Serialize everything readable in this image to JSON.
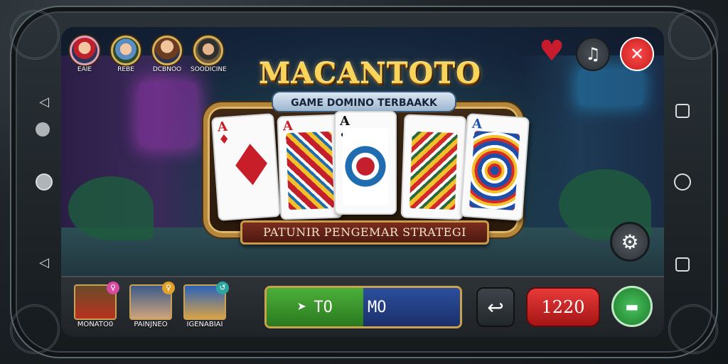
{
  "players": [
    {
      "name": "EAIE",
      "icon": "player-avatar-icon"
    },
    {
      "name": "REBE",
      "icon": "player-avatar-icon"
    },
    {
      "name": "DCBNOO",
      "icon": "player-avatar-icon"
    },
    {
      "name": "SOODICINE",
      "icon": "player-avatar-icon"
    }
  ],
  "title": "MACANTOTO",
  "subtitle": "GAME DOMINO TERBAAKK",
  "cards": [
    {
      "rank": "A",
      "suit": "♦"
    },
    {
      "rank": "A",
      "suit": "♦"
    },
    {
      "rank": "A",
      "suit": "♣"
    },
    {
      "rank": "",
      "suit": ""
    },
    {
      "rank": "A",
      "suit": "♠"
    }
  ],
  "banner": "PATUNIR PENGEMAR STRATEGI",
  "bottom": {
    "items": [
      {
        "label": "MONATO0",
        "badge": "♀"
      },
      {
        "label": "PAINJNEO",
        "badge": "♀"
      },
      {
        "label": "IGENABIAI",
        "badge": "↺"
      }
    ],
    "play_left": "TO",
    "play_right": "MO",
    "score": "1220"
  },
  "colors": {
    "accent_gold": "#f9d45a",
    "play_green": "#4caf3a",
    "play_blue": "#2c4f9e",
    "score_red": "#e83a3a",
    "close_red": "#ff4a4a"
  }
}
